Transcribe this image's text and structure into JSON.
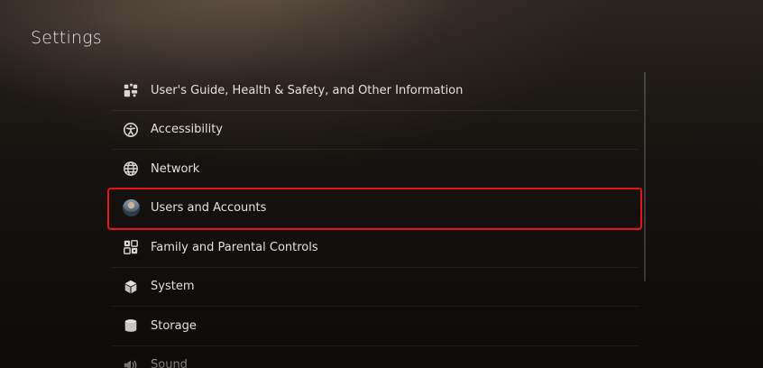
{
  "header": {
    "title": "Settings"
  },
  "menu": {
    "items": [
      {
        "label": "User's Guide, Health & Safety, and Other Information",
        "icon": "guide-icon"
      },
      {
        "label": "Accessibility",
        "icon": "accessibility-icon"
      },
      {
        "label": "Network",
        "icon": "globe-icon"
      },
      {
        "label": "Users and Accounts",
        "icon": "avatar",
        "selected": true
      },
      {
        "label": "Family and Parental Controls",
        "icon": "family-icon"
      },
      {
        "label": "System",
        "icon": "cube-icon"
      },
      {
        "label": "Storage",
        "icon": "storage-icon"
      },
      {
        "label": "Sound",
        "icon": "speaker-icon"
      }
    ]
  },
  "colors": {
    "selection_outline": "#e8141c",
    "text": "#e2e0dd",
    "background": "#0f0d0b"
  }
}
